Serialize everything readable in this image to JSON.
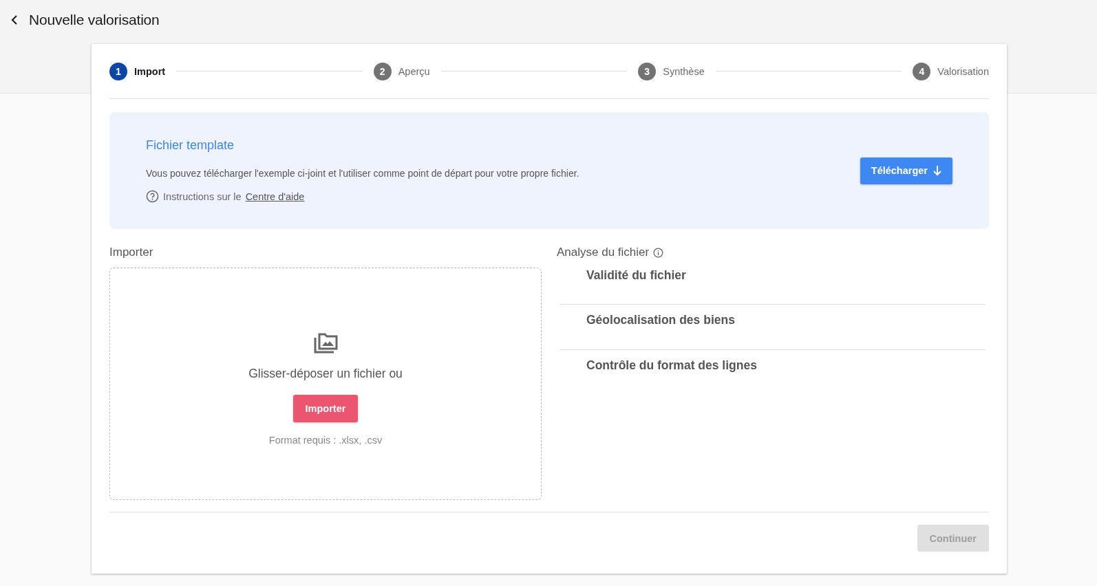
{
  "page": {
    "title": "Nouvelle valorisation"
  },
  "steps": [
    {
      "number": "1",
      "label": "Import",
      "selected": true
    },
    {
      "number": "2",
      "label": "Aperçu",
      "selected": false
    },
    {
      "number": "3",
      "label": "Synthèse",
      "selected": false
    },
    {
      "number": "4",
      "label": "Valorisation",
      "selected": false
    }
  ],
  "template": {
    "title": "Fichier template",
    "description": "Vous pouvez télécharger l'exemple ci-joint et l'utiliser comme point de départ pour votre propre fichier.",
    "help_prefix": "Instructions sur le",
    "help_link": "Centre d'aide",
    "download_button": "Télécharger"
  },
  "import": {
    "title": "Importer",
    "drop_text": "Glisser-déposer un fichier ou",
    "button": "Importer",
    "formats": "Format requis : .xlsx, .csv"
  },
  "analysis": {
    "title": "Analyse du fichier",
    "checks": [
      "Validité du fichier",
      "Géolocalisation des biens",
      "Contrôle du format des lignes"
    ]
  },
  "footer": {
    "continue_button": "Continuer",
    "continue_disabled": true
  }
}
